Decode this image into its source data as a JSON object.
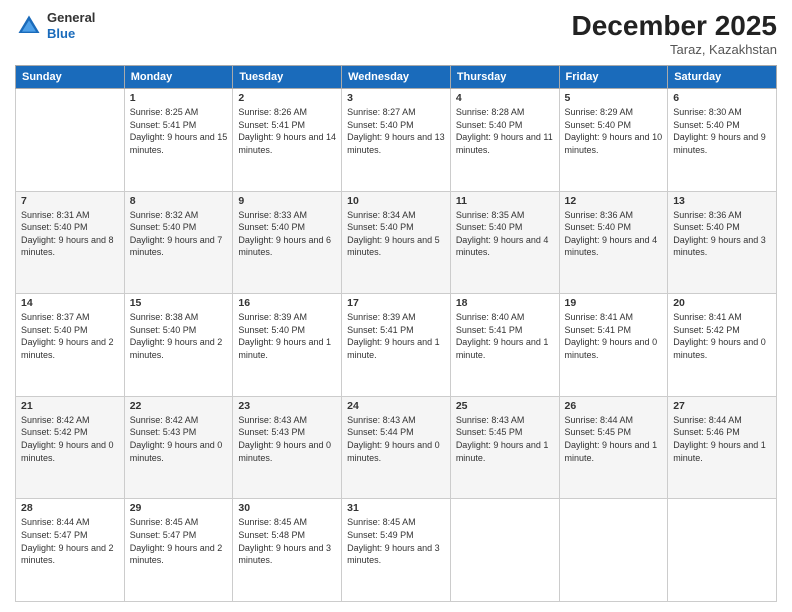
{
  "logo": {
    "general": "General",
    "blue": "Blue"
  },
  "title": "December 2025",
  "location": "Taraz, Kazakhstan",
  "days_of_week": [
    "Sunday",
    "Monday",
    "Tuesday",
    "Wednesday",
    "Thursday",
    "Friday",
    "Saturday"
  ],
  "weeks": [
    [
      {
        "day": "",
        "info": ""
      },
      {
        "day": "1",
        "info": "Sunrise: 8:25 AM\nSunset: 5:41 PM\nDaylight: 9 hours and 15 minutes."
      },
      {
        "day": "2",
        "info": "Sunrise: 8:26 AM\nSunset: 5:41 PM\nDaylight: 9 hours and 14 minutes."
      },
      {
        "day": "3",
        "info": "Sunrise: 8:27 AM\nSunset: 5:40 PM\nDaylight: 9 hours and 13 minutes."
      },
      {
        "day": "4",
        "info": "Sunrise: 8:28 AM\nSunset: 5:40 PM\nDaylight: 9 hours and 11 minutes."
      },
      {
        "day": "5",
        "info": "Sunrise: 8:29 AM\nSunset: 5:40 PM\nDaylight: 9 hours and 10 minutes."
      },
      {
        "day": "6",
        "info": "Sunrise: 8:30 AM\nSunset: 5:40 PM\nDaylight: 9 hours and 9 minutes."
      }
    ],
    [
      {
        "day": "7",
        "info": "Sunrise: 8:31 AM\nSunset: 5:40 PM\nDaylight: 9 hours and 8 minutes."
      },
      {
        "day": "8",
        "info": "Sunrise: 8:32 AM\nSunset: 5:40 PM\nDaylight: 9 hours and 7 minutes."
      },
      {
        "day": "9",
        "info": "Sunrise: 8:33 AM\nSunset: 5:40 PM\nDaylight: 9 hours and 6 minutes."
      },
      {
        "day": "10",
        "info": "Sunrise: 8:34 AM\nSunset: 5:40 PM\nDaylight: 9 hours and 5 minutes."
      },
      {
        "day": "11",
        "info": "Sunrise: 8:35 AM\nSunset: 5:40 PM\nDaylight: 9 hours and 4 minutes."
      },
      {
        "day": "12",
        "info": "Sunrise: 8:36 AM\nSunset: 5:40 PM\nDaylight: 9 hours and 4 minutes."
      },
      {
        "day": "13",
        "info": "Sunrise: 8:36 AM\nSunset: 5:40 PM\nDaylight: 9 hours and 3 minutes."
      }
    ],
    [
      {
        "day": "14",
        "info": "Sunrise: 8:37 AM\nSunset: 5:40 PM\nDaylight: 9 hours and 2 minutes."
      },
      {
        "day": "15",
        "info": "Sunrise: 8:38 AM\nSunset: 5:40 PM\nDaylight: 9 hours and 2 minutes."
      },
      {
        "day": "16",
        "info": "Sunrise: 8:39 AM\nSunset: 5:40 PM\nDaylight: 9 hours and 1 minute."
      },
      {
        "day": "17",
        "info": "Sunrise: 8:39 AM\nSunset: 5:41 PM\nDaylight: 9 hours and 1 minute."
      },
      {
        "day": "18",
        "info": "Sunrise: 8:40 AM\nSunset: 5:41 PM\nDaylight: 9 hours and 1 minute."
      },
      {
        "day": "19",
        "info": "Sunrise: 8:41 AM\nSunset: 5:41 PM\nDaylight: 9 hours and 0 minutes."
      },
      {
        "day": "20",
        "info": "Sunrise: 8:41 AM\nSunset: 5:42 PM\nDaylight: 9 hours and 0 minutes."
      }
    ],
    [
      {
        "day": "21",
        "info": "Sunrise: 8:42 AM\nSunset: 5:42 PM\nDaylight: 9 hours and 0 minutes."
      },
      {
        "day": "22",
        "info": "Sunrise: 8:42 AM\nSunset: 5:43 PM\nDaylight: 9 hours and 0 minutes."
      },
      {
        "day": "23",
        "info": "Sunrise: 8:43 AM\nSunset: 5:43 PM\nDaylight: 9 hours and 0 minutes."
      },
      {
        "day": "24",
        "info": "Sunrise: 8:43 AM\nSunset: 5:44 PM\nDaylight: 9 hours and 0 minutes."
      },
      {
        "day": "25",
        "info": "Sunrise: 8:43 AM\nSunset: 5:45 PM\nDaylight: 9 hours and 1 minute."
      },
      {
        "day": "26",
        "info": "Sunrise: 8:44 AM\nSunset: 5:45 PM\nDaylight: 9 hours and 1 minute."
      },
      {
        "day": "27",
        "info": "Sunrise: 8:44 AM\nSunset: 5:46 PM\nDaylight: 9 hours and 1 minute."
      }
    ],
    [
      {
        "day": "28",
        "info": "Sunrise: 8:44 AM\nSunset: 5:47 PM\nDaylight: 9 hours and 2 minutes."
      },
      {
        "day": "29",
        "info": "Sunrise: 8:45 AM\nSunset: 5:47 PM\nDaylight: 9 hours and 2 minutes."
      },
      {
        "day": "30",
        "info": "Sunrise: 8:45 AM\nSunset: 5:48 PM\nDaylight: 9 hours and 3 minutes."
      },
      {
        "day": "31",
        "info": "Sunrise: 8:45 AM\nSunset: 5:49 PM\nDaylight: 9 hours and 3 minutes."
      },
      {
        "day": "",
        "info": ""
      },
      {
        "day": "",
        "info": ""
      },
      {
        "day": "",
        "info": ""
      }
    ]
  ]
}
